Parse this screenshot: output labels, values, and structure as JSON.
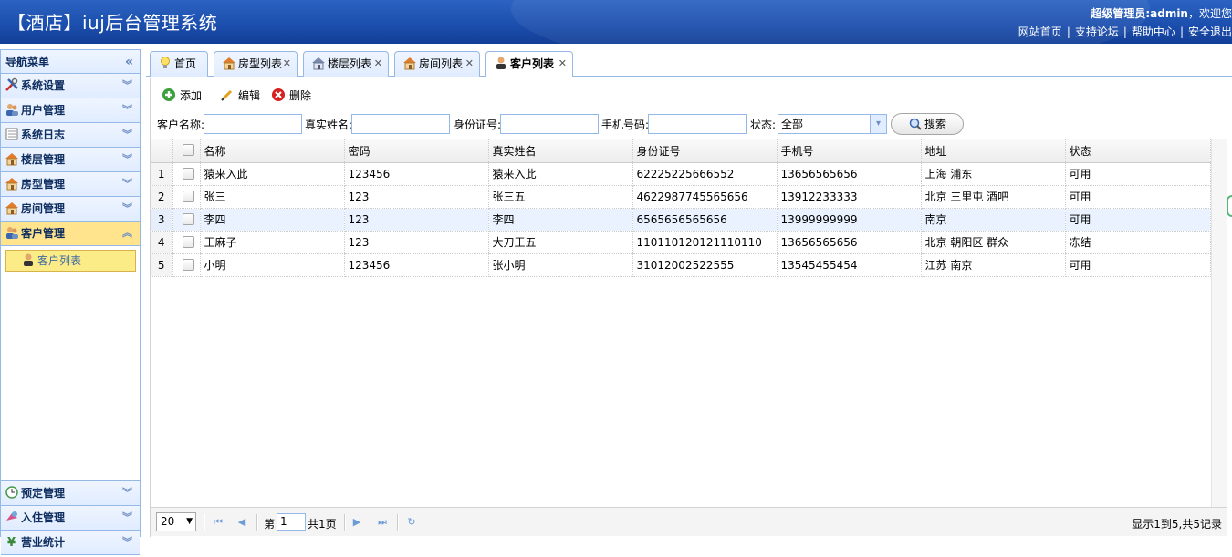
{
  "header": {
    "title": "【酒店】iuj后台管理系统",
    "welcome_user": "超级管理员:admin",
    "welcome_suffix": "，欢迎您",
    "links": [
      "网站首页",
      "支持论坛",
      "帮助中心",
      "安全退出"
    ]
  },
  "nav": {
    "title": "导航菜单",
    "collapse_icon": "«",
    "items": [
      {
        "label": "系统设置",
        "icon": "tools-icon"
      },
      {
        "label": "用户管理",
        "icon": "users-icon"
      },
      {
        "label": "系统日志",
        "icon": "log-icon"
      },
      {
        "label": "楼层管理",
        "icon": "house-icon"
      },
      {
        "label": "房型管理",
        "icon": "house-icon"
      },
      {
        "label": "房间管理",
        "icon": "house-icon"
      },
      {
        "label": "客户管理",
        "icon": "customers-icon",
        "active": true
      },
      {
        "label": "预定管理",
        "icon": "clock-icon"
      },
      {
        "label": "入住管理",
        "icon": "checkin-icon"
      },
      {
        "label": "营业统计",
        "icon": "yen-icon"
      }
    ],
    "sub_item": "客户列表"
  },
  "tabs": [
    {
      "label": "首页",
      "icon": "bulb-icon",
      "closable": false
    },
    {
      "label": "房型列表",
      "icon": "house-icon",
      "closable": true
    },
    {
      "label": "楼层列表",
      "icon": "house-icon",
      "closable": true
    },
    {
      "label": "房间列表",
      "icon": "house-icon",
      "closable": true
    },
    {
      "label": "客户列表",
      "icon": "user-icon",
      "closable": true,
      "active": true
    }
  ],
  "toolbar": {
    "add": "添加",
    "edit": "编辑",
    "delete": "删除"
  },
  "search": {
    "name_label": "客户名称:",
    "realname_label": "真实姓名:",
    "idcard_label": "身份证号:",
    "phone_label": "手机号码:",
    "status_label": "状态:",
    "status_value": "全部",
    "button": "搜索"
  },
  "grid": {
    "columns": [
      "名称",
      "密码",
      "真实姓名",
      "身份证号",
      "手机号",
      "地址",
      "状态"
    ],
    "rows": [
      [
        "猿来入此",
        "123456",
        "猿来入此",
        "62225225666552",
        "13656565656",
        "上海 浦东",
        "可用"
      ],
      [
        "张三",
        "123",
        "张三五",
        "4622987745565656",
        "13912233333",
        "北京 三里屯 酒吧",
        "可用"
      ],
      [
        "李四",
        "123",
        "李四",
        "6565656565656",
        "13999999999",
        "南京",
        "可用"
      ],
      [
        "王麻子",
        "123",
        "大刀王五",
        "110110120121110110",
        "13656565656",
        "北京 朝阳区 群众",
        "冻结"
      ],
      [
        "小明",
        "123456",
        "张小明",
        "31012002522555",
        "13545455454",
        "江苏 南京",
        "可用"
      ]
    ],
    "row_numbers": [
      "1",
      "2",
      "3",
      "4",
      "5"
    ],
    "highlighted_row": 3
  },
  "pager": {
    "page_size": "20",
    "page_prefix": "第",
    "page_value": "1",
    "page_total": "共1页",
    "info": "显示1到5,共5记录"
  },
  "colors": {
    "header": "#1c4fae",
    "nav_border": "#95b8e7",
    "active_nav": "#ffe48d"
  }
}
